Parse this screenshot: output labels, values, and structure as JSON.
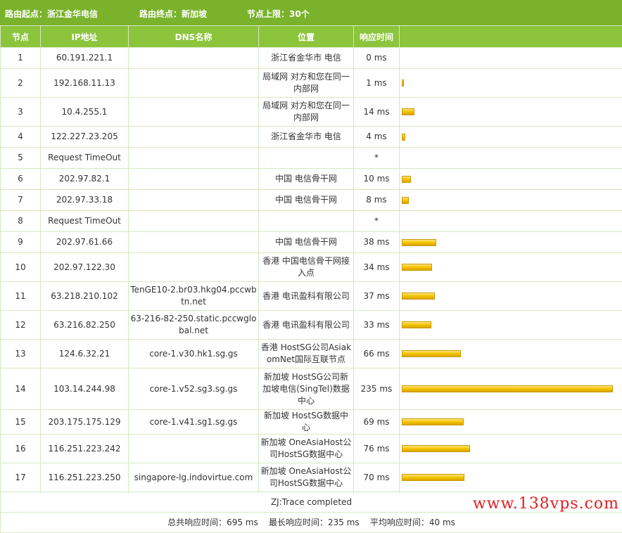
{
  "header": {
    "route_start": "路由起点：浙江金华电信",
    "route_end": "路由终点：新加坡",
    "node_limit": "节点上限：30个"
  },
  "columns": [
    "节点",
    "IP地址",
    "DNS名称",
    "位置",
    "响应时间",
    ""
  ],
  "rows": [
    {
      "node": "1",
      "ip": "60.191.221.1",
      "dns": "",
      "location": "浙江省金华市 电信",
      "time": "0 ms",
      "time_ms": 0
    },
    {
      "node": "2",
      "ip": "192.168.11.13",
      "dns": "",
      "location": "局域网 对方和您在同一内部网",
      "time": "1 ms",
      "time_ms": 1
    },
    {
      "node": "3",
      "ip": "10.4.255.1",
      "dns": "",
      "location": "局域网 对方和您在同一内部网",
      "time": "14 ms",
      "time_ms": 14
    },
    {
      "node": "4",
      "ip": "122.227.23.205",
      "dns": "",
      "location": "浙江省金华市 电信",
      "time": "4 ms",
      "time_ms": 4
    },
    {
      "node": "5",
      "ip": "Request TimeOut",
      "dns": "",
      "location": "",
      "time": "*",
      "time_ms": 0
    },
    {
      "node": "6",
      "ip": "202.97.82.1",
      "dns": "",
      "location": "中国 电信骨干网",
      "time": "10 ms",
      "time_ms": 10
    },
    {
      "node": "7",
      "ip": "202.97.33.18",
      "dns": "",
      "location": "中国 电信骨干网",
      "time": "8 ms",
      "time_ms": 8
    },
    {
      "node": "8",
      "ip": "Request TimeOut",
      "dns": "",
      "location": "",
      "time": "*",
      "time_ms": 0
    },
    {
      "node": "9",
      "ip": "202.97.61.66",
      "dns": "",
      "location": "中国 电信骨干网",
      "time": "38 ms",
      "time_ms": 38
    },
    {
      "node": "10",
      "ip": "202.97.122.30",
      "dns": "",
      "location": "香港 中国电信骨干网接入点",
      "time": "34 ms",
      "time_ms": 34
    },
    {
      "node": "11",
      "ip": "63.218.210.102",
      "dns": "TenGE10-2.br03.hkg04.pccwbtn.net",
      "location": "香港 电讯盈科有限公司",
      "time": "37 ms",
      "time_ms": 37
    },
    {
      "node": "12",
      "ip": "63.216.82.250",
      "dns": "63-216-82-250.static.pccwglobal.net",
      "location": "香港 电讯盈科有限公司",
      "time": "33 ms",
      "time_ms": 33
    },
    {
      "node": "13",
      "ip": "124.6.32.21",
      "dns": "core-1.v30.hk1.sg.gs",
      "location": "香港 HostSG公司AsiakomNet国际互联节点",
      "time": "66 ms",
      "time_ms": 66
    },
    {
      "node": "14",
      "ip": "103.14.244.98",
      "dns": "core-1.v52.sg3.sg.gs",
      "location": "新加坡 HostSG公司新加坡电信(SingTel)数据中心",
      "time": "235 ms",
      "time_ms": 235
    },
    {
      "node": "15",
      "ip": "203.175.175.129",
      "dns": "core-1.v41.sg1.sg.gs",
      "location": "新加坡 HostSG数据中心",
      "time": "69 ms",
      "time_ms": 69
    },
    {
      "node": "16",
      "ip": "116.251.223.242",
      "dns": "",
      "location": "新加坡 OneAsiaHost公司HostSG数据中心",
      "time": "76 ms",
      "time_ms": 76
    },
    {
      "node": "17",
      "ip": "116.251.223.250",
      "dns": "singapore-lg.indovirtue.com",
      "location": "新加坡 OneAsiaHost公司HostSG数据中心",
      "time": "70 ms",
      "time_ms": 70
    }
  ],
  "bar_max_ms": 235,
  "footer": {
    "completed": "ZJ:Trace completed",
    "summary": "总共响应时间：695 ms    最长响应时间：235 ms    平均响应时间：40 ms"
  },
  "watermark": "www.138vps.com",
  "colors": {
    "header_bg": "#7ab22c",
    "column_header_bg": "#8cc43c",
    "bar": "#f7c600",
    "watermark": "#e02020"
  }
}
